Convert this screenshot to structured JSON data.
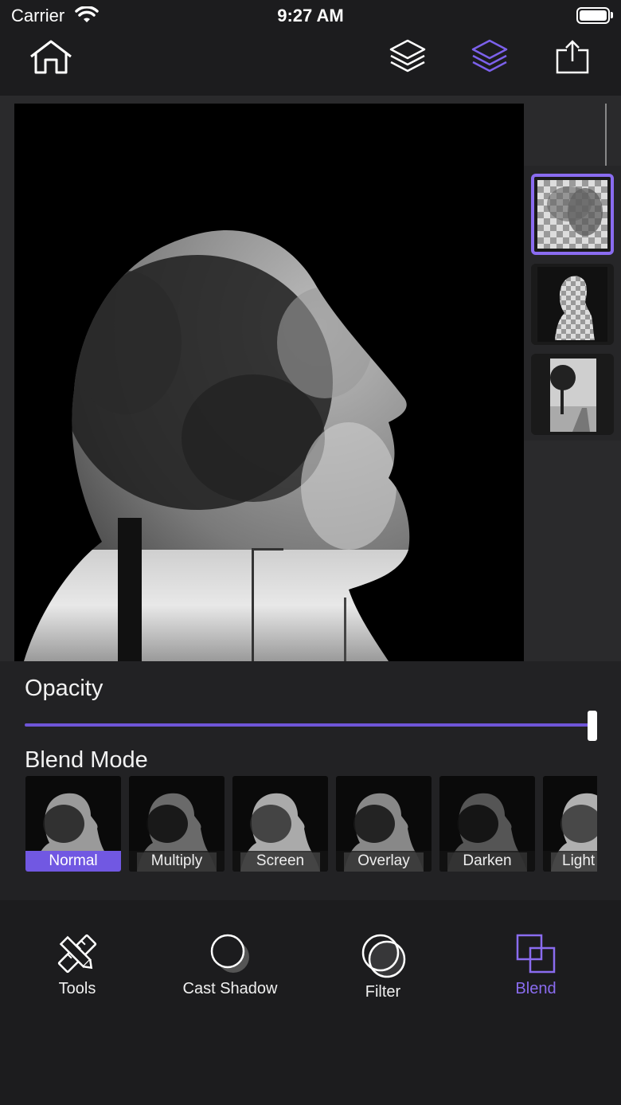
{
  "status_bar": {
    "carrier": "Carrier",
    "time": "9:27 AM"
  },
  "toolbar": {
    "home_icon": "home-icon",
    "layers_icon": "layers-icon",
    "layers_active_icon": "layers-active-icon",
    "share_icon": "share-icon"
  },
  "layers": [
    {
      "name": "portrait-cutout",
      "selected": true
    },
    {
      "name": "silhouette-mask",
      "selected": false
    },
    {
      "name": "tree-road-photo",
      "selected": false
    }
  ],
  "opacity": {
    "label": "Opacity",
    "value": 1.0
  },
  "blend_mode": {
    "label": "Blend Mode",
    "modes": [
      "Normal",
      "Multiply",
      "Screen",
      "Overlay",
      "Darken",
      "Lighten"
    ],
    "visible_labels": [
      "Normal",
      "Multiply",
      "Screen",
      "Overlay",
      "Darken",
      "Light"
    ],
    "selected": "Normal"
  },
  "tabs": [
    {
      "label": "Tools",
      "icon": "tools-icon",
      "active": false
    },
    {
      "label": "Cast Shadow",
      "icon": "cast-shadow-icon",
      "active": false
    },
    {
      "label": "Filter",
      "icon": "filter-icon",
      "active": false
    },
    {
      "label": "Blend",
      "icon": "blend-icon",
      "active": true
    }
  ],
  "colors": {
    "accent": "#8a6cf0",
    "background": "#1c1c1e",
    "panel": "#222224"
  }
}
